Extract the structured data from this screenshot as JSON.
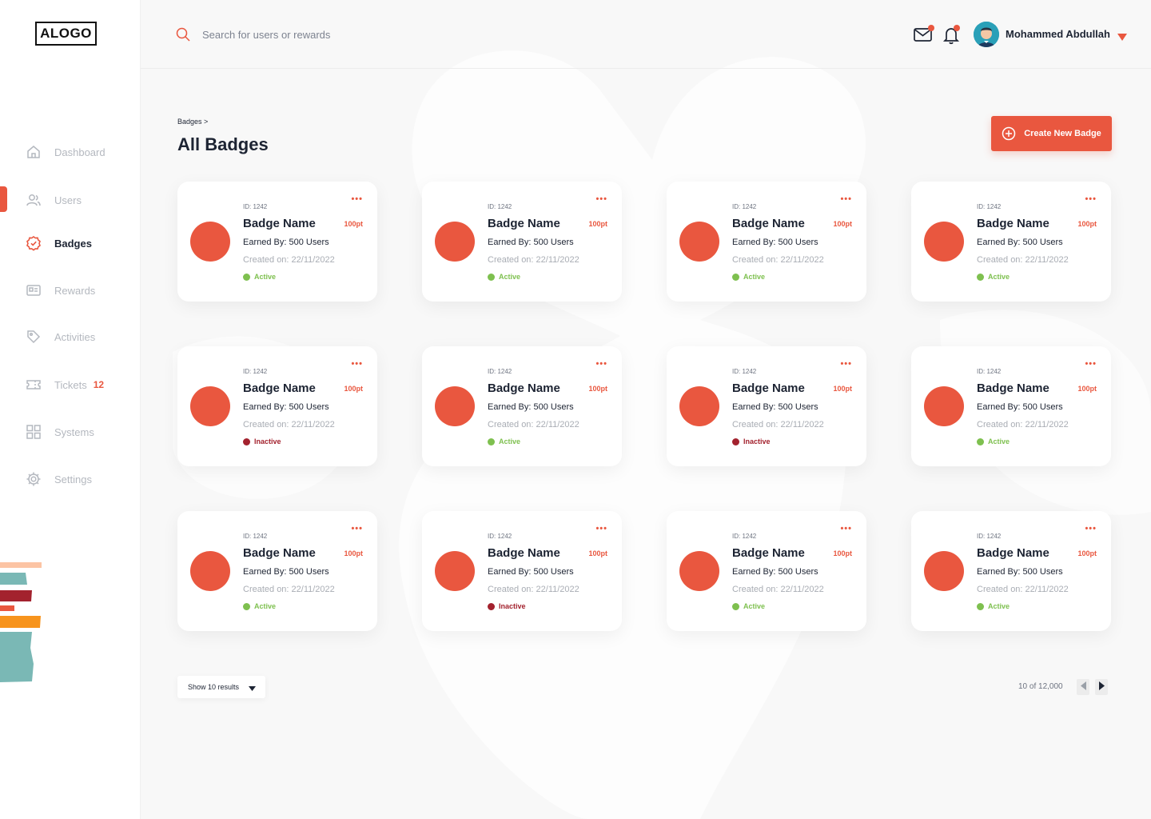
{
  "app": {
    "logo_text": "ALOGO",
    "accent_color": "#e9573f"
  },
  "sidebar": {
    "items": [
      {
        "label": "Dashboard",
        "icon": "home-icon",
        "active": false
      },
      {
        "label": "Users",
        "icon": "users-icon",
        "active": false
      },
      {
        "label": "Badges",
        "icon": "badge-icon",
        "active": true
      },
      {
        "label": "Rewards",
        "icon": "rewards-icon",
        "active": false
      },
      {
        "label": "Activities",
        "icon": "tag-icon",
        "active": false
      },
      {
        "label": "Tickets",
        "icon": "ticket-icon",
        "active": false,
        "count": "12"
      },
      {
        "label": "Systems",
        "icon": "grid-icon",
        "active": false
      },
      {
        "label": "Settings",
        "icon": "gear-icon",
        "active": false
      }
    ]
  },
  "header": {
    "search_placeholder": "Search for users or rewards",
    "user_name": "Mohammed Abdullah"
  },
  "page": {
    "breadcrumb": "Badges >",
    "title": "All Badges",
    "create_button": "Create New Badge"
  },
  "cards": [
    {
      "id": "ID: 1242",
      "name": "Badge Name",
      "points": "100pt",
      "earned": "Earned By: 500 Users",
      "created": "Created on: 22/11/2022",
      "status": "Active"
    },
    {
      "id": "ID: 1242",
      "name": "Badge Name",
      "points": "100pt",
      "earned": "Earned By: 500 Users",
      "created": "Created on: 22/11/2022",
      "status": "Active"
    },
    {
      "id": "ID: 1242",
      "name": "Badge Name",
      "points": "100pt",
      "earned": "Earned By: 500 Users",
      "created": "Created on: 22/11/2022",
      "status": "Active"
    },
    {
      "id": "ID: 1242",
      "name": "Badge Name",
      "points": "100pt",
      "earned": "Earned By: 500 Users",
      "created": "Created on: 22/11/2022",
      "status": "Active"
    },
    {
      "id": "ID: 1242",
      "name": "Badge Name",
      "points": "100pt",
      "earned": "Earned By: 500 Users",
      "created": "Created on: 22/11/2022",
      "status": "Inactive"
    },
    {
      "id": "ID: 1242",
      "name": "Badge Name",
      "points": "100pt",
      "earned": "Earned By: 500 Users",
      "created": "Created on: 22/11/2022",
      "status": "Active"
    },
    {
      "id": "ID: 1242",
      "name": "Badge Name",
      "points": "100pt",
      "earned": "Earned By: 500 Users",
      "created": "Created on: 22/11/2022",
      "status": "Inactive"
    },
    {
      "id": "ID: 1242",
      "name": "Badge Name",
      "points": "100pt",
      "earned": "Earned By: 500 Users",
      "created": "Created on: 22/11/2022",
      "status": "Active"
    },
    {
      "id": "ID: 1242",
      "name": "Badge Name",
      "points": "100pt",
      "earned": "Earned By: 500 Users",
      "created": "Created on: 22/11/2022",
      "status": "Active"
    },
    {
      "id": "ID: 1242",
      "name": "Badge Name",
      "points": "100pt",
      "earned": "Earned By: 500 Users",
      "created": "Created on: 22/11/2022",
      "status": "Inactive"
    },
    {
      "id": "ID: 1242",
      "name": "Badge Name",
      "points": "100pt",
      "earned": "Earned By: 500 Users",
      "created": "Created on: 22/11/2022",
      "status": "Active"
    },
    {
      "id": "ID: 1242",
      "name": "Badge Name",
      "points": "100pt",
      "earned": "Earned By: 500 Users",
      "created": "Created on: 22/11/2022",
      "status": "Active"
    }
  ],
  "footer": {
    "show_results": "Show 10 results",
    "page_info": "10 of 12,000"
  }
}
